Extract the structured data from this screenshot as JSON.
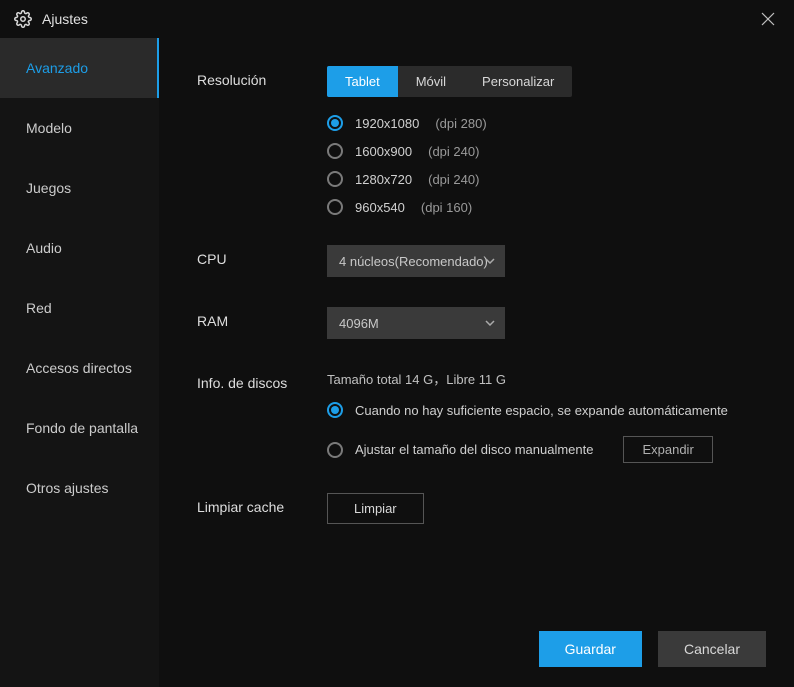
{
  "window": {
    "title": "Ajustes"
  },
  "sidebar": {
    "items": [
      {
        "label": "Avanzado",
        "active": true
      },
      {
        "label": "Modelo"
      },
      {
        "label": "Juegos"
      },
      {
        "label": "Audio"
      },
      {
        "label": "Red"
      },
      {
        "label": "Accesos directos"
      },
      {
        "label": "Fondo de pantalla"
      },
      {
        "label": "Otros ajustes"
      }
    ]
  },
  "resolution": {
    "label": "Resolución",
    "tabs": [
      {
        "label": "Tablet",
        "active": true
      },
      {
        "label": "Móvil"
      },
      {
        "label": "Personalizar"
      }
    ],
    "options": [
      {
        "main": "1920x1080",
        "sub": "(dpi 280)",
        "checked": true
      },
      {
        "main": "1600x900",
        "sub": "(dpi 240)"
      },
      {
        "main": "1280x720",
        "sub": "(dpi 240)"
      },
      {
        "main": "960x540",
        "sub": "(dpi 160)"
      }
    ]
  },
  "cpu": {
    "label": "CPU",
    "value": "4 núcleos(Recomendado)"
  },
  "ram": {
    "label": "RAM",
    "value": "4096M"
  },
  "disk": {
    "label": "Info. de discos",
    "info": "Tamaño total 14 G，Libre 11 G",
    "opt1": "Cuando no hay suficiente espacio, se expande automáticamente",
    "opt2": "Ajustar el tamaño del disco manualmente",
    "expand_btn": "Expandir"
  },
  "cache": {
    "label": "Limpiar cache",
    "btn": "Limpiar"
  },
  "footer": {
    "save": "Guardar",
    "cancel": "Cancelar"
  }
}
